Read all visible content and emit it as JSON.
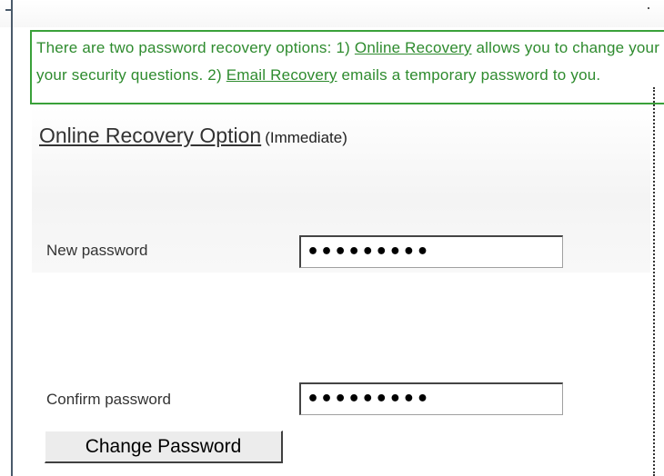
{
  "info_box": {
    "line1_prefix": "There are two password recovery options: 1) ",
    "line1_link": "Online Recovery",
    "line1_suffix": " allows you to change your password after answering",
    "line2_prefix": "your security questions. 2) ",
    "line2_link": "Email Recovery",
    "line2_suffix": " emails a temporary password to you."
  },
  "section": {
    "title": "Online Recovery Option",
    "subtitle": "(Immediate)"
  },
  "fields": {
    "new_password_label": "New password",
    "new_password_value": "•••••••••",
    "confirm_password_label": "Confirm password",
    "confirm_password_value": "•••••••••"
  },
  "actions": {
    "change_password_label": "Change Password"
  },
  "colors": {
    "notice_green": "#2e8b2e",
    "notice_border": "#3aa13a"
  }
}
